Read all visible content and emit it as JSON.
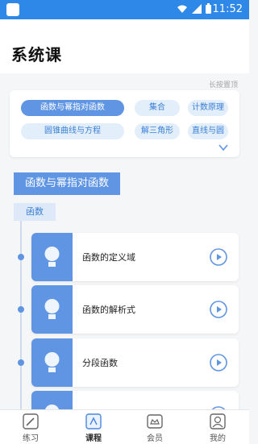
{
  "status_bar": {
    "time": "11:52"
  },
  "page_title": "系统课",
  "pin_hint": "长按置顶",
  "chips": [
    {
      "label": "函数与幂指对函数",
      "active": true
    },
    {
      "label": "集合",
      "active": false
    },
    {
      "label": "计数原理",
      "active": false
    },
    {
      "label": "圆锥曲线与方程",
      "active": false
    },
    {
      "label": "解三角形",
      "active": false
    },
    {
      "label": "直线与圆",
      "active": false
    }
  ],
  "section": {
    "title": "函数与幂指对函数",
    "subtitle": "函数"
  },
  "lessons": [
    {
      "title": "函数的定义域"
    },
    {
      "title": "函数的解析式"
    },
    {
      "title": "分段函数"
    },
    {
      "title": ""
    }
  ],
  "tabs": [
    {
      "label": "练习",
      "icon": "pencil-icon"
    },
    {
      "label": "课程",
      "icon": "course-icon",
      "active": true
    },
    {
      "label": "会员",
      "icon": "vip-icon"
    },
    {
      "label": "我的",
      "icon": "profile-icon"
    }
  ],
  "colors": {
    "status_bar": "#2e88e8",
    "accent": "#5f95e3",
    "chip_bg": "#e3eefb"
  }
}
